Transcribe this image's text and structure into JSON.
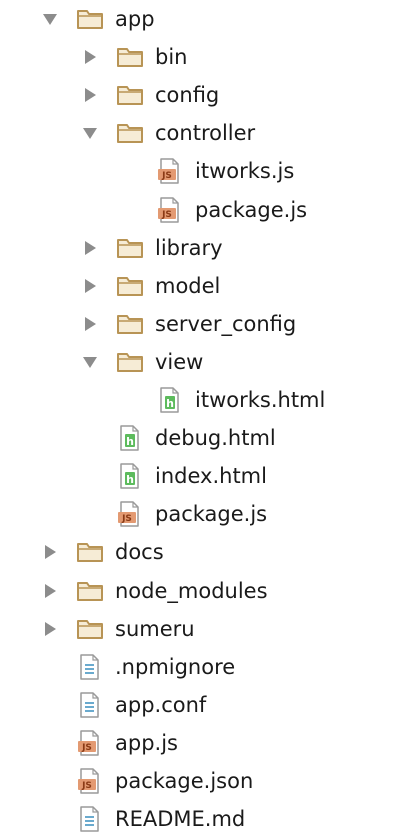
{
  "tree": [
    {
      "label": "app",
      "type": "folder",
      "state": "expanded",
      "depth": 0
    },
    {
      "label": "bin",
      "type": "folder",
      "state": "collapsed",
      "depth": 1
    },
    {
      "label": "config",
      "type": "folder",
      "state": "collapsed",
      "depth": 1
    },
    {
      "label": "controller",
      "type": "folder",
      "state": "expanded",
      "depth": 1
    },
    {
      "label": "itworks.js",
      "type": "js",
      "depth": 2
    },
    {
      "label": "package.js",
      "type": "js",
      "depth": 2
    },
    {
      "label": "library",
      "type": "folder",
      "state": "collapsed",
      "depth": 1
    },
    {
      "label": "model",
      "type": "folder",
      "state": "collapsed",
      "depth": 1
    },
    {
      "label": "server_config",
      "type": "folder",
      "state": "collapsed",
      "depth": 1
    },
    {
      "label": "view",
      "type": "folder",
      "state": "expanded",
      "depth": 1
    },
    {
      "label": "itworks.html",
      "type": "html",
      "depth": 2
    },
    {
      "label": "debug.html",
      "type": "html",
      "depth": 1
    },
    {
      "label": "index.html",
      "type": "html",
      "depth": 1
    },
    {
      "label": "package.js",
      "type": "js",
      "depth": 1
    },
    {
      "label": "docs",
      "type": "folder",
      "state": "collapsed",
      "depth": 0
    },
    {
      "label": "node_modules",
      "type": "folder",
      "state": "collapsed",
      "depth": 0
    },
    {
      "label": "sumeru",
      "type": "folder",
      "state": "collapsed",
      "depth": 0
    },
    {
      "label": ".npmignore",
      "type": "text",
      "depth": 0
    },
    {
      "label": "app.conf",
      "type": "text",
      "depth": 0
    },
    {
      "label": "app.js",
      "type": "js",
      "depth": 0
    },
    {
      "label": "package.json",
      "type": "js",
      "depth": 0
    },
    {
      "label": "README.md",
      "type": "text",
      "depth": 0
    }
  ],
  "icons": {
    "folder": "folder-icon",
    "js": "js-file-icon",
    "html": "html-file-icon",
    "text": "text-file-icon",
    "expanded": "chevron-down-icon",
    "collapsed": "chevron-right-icon"
  },
  "colors": {
    "folder_stroke": "#b89455",
    "folder_fill": "#f6ecd6",
    "arrow": "#8c8c8c",
    "js_badge": "#e39a72",
    "html_badge": "#5dbb5d",
    "text_lines": "#5aa0c8"
  }
}
